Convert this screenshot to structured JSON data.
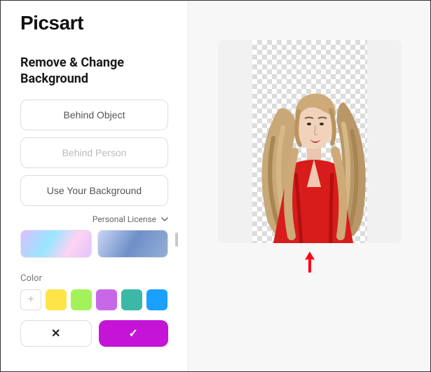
{
  "brand": "Picsart",
  "section_title": "Remove & Change Background",
  "options": {
    "behind_object": "Behind Object",
    "behind_person": "Behind Person",
    "use_your_bg": "Use Your Background"
  },
  "license": {
    "label": "Personal License"
  },
  "color_section": {
    "label": "Color",
    "add_symbol": "+",
    "swatches": [
      "#ffe448",
      "#a4f25a",
      "#c768e8",
      "#3bb8a8",
      "#1aa0ff"
    ]
  },
  "actions": {
    "cancel_symbol": "✕",
    "confirm_symbol": "✓",
    "confirm_bg": "#c415d6"
  },
  "canvas": {
    "arrow_color": "#ff0019"
  }
}
